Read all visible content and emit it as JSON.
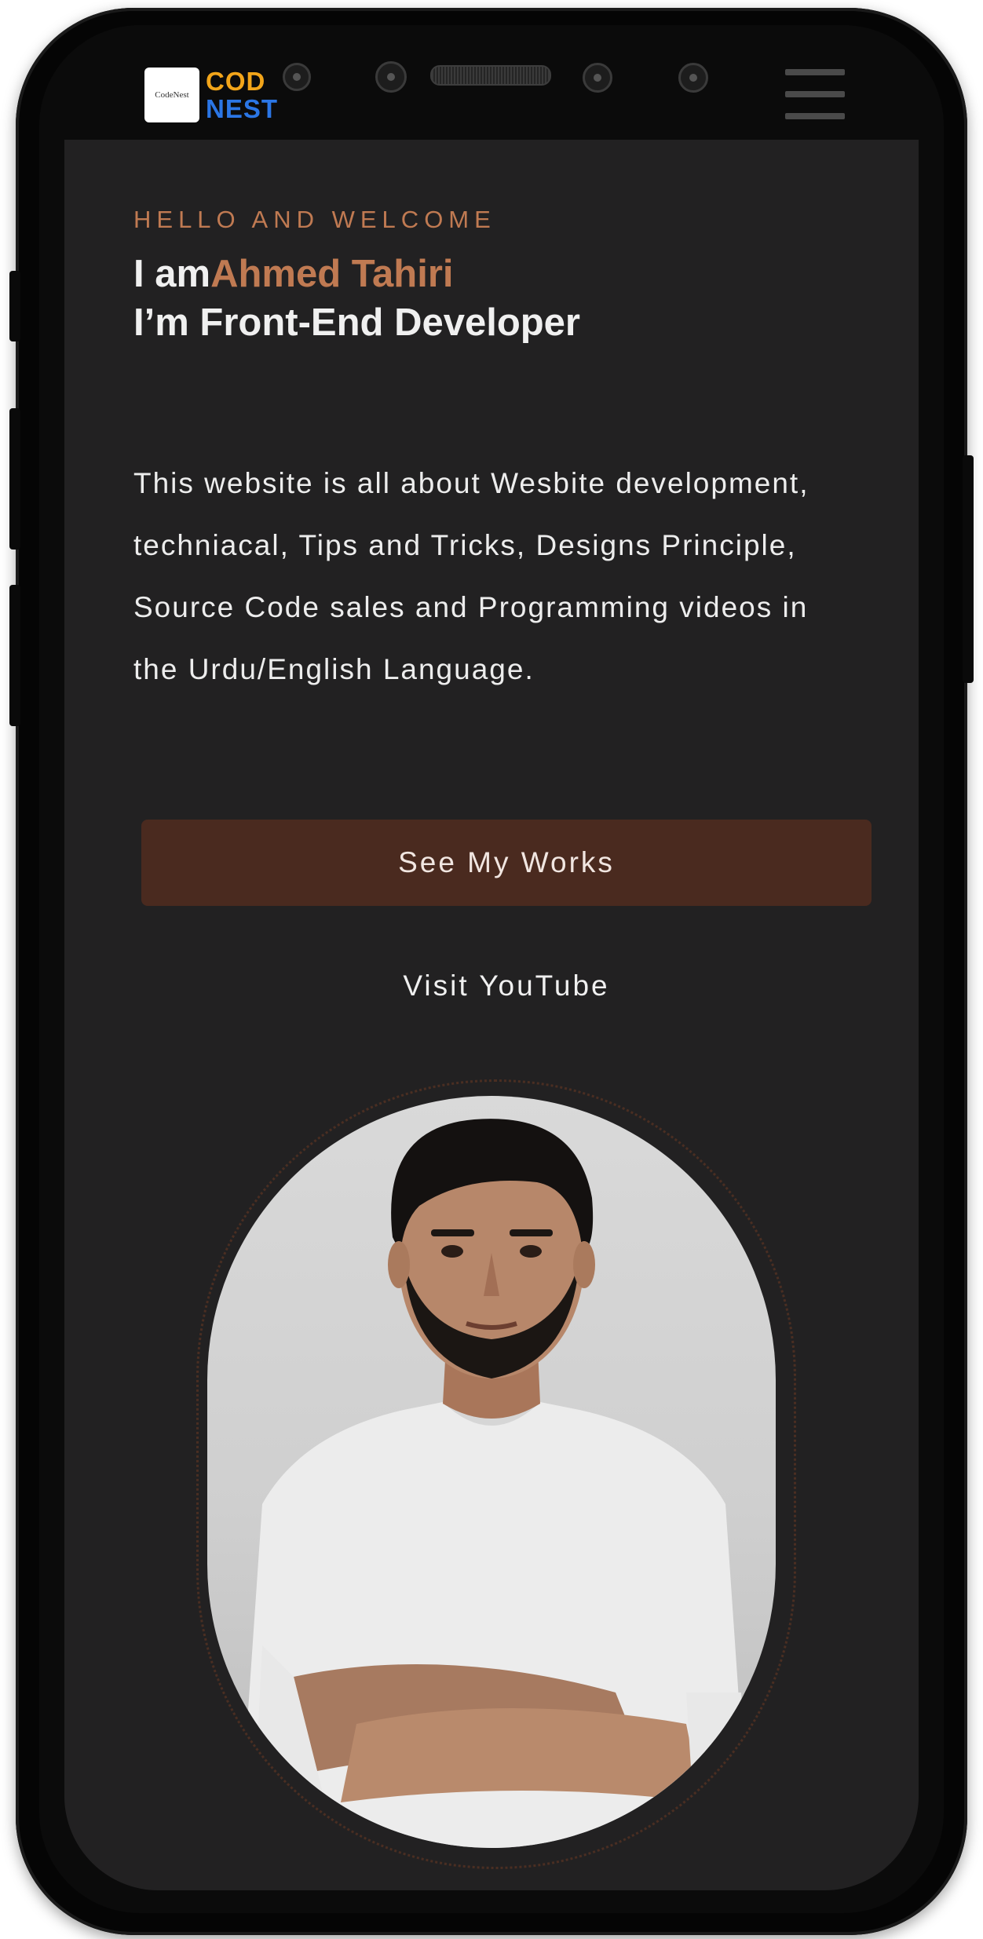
{
  "header": {
    "logo_small_text": "CodeNest",
    "logo_line1": "COD",
    "logo_line2": "NEST",
    "menu_icon": "hamburger-icon"
  },
  "hero": {
    "kicker": "HELLO AND  WELCOME",
    "intro_prefix": "I am",
    "intro_name": "Ahmed Tahiri",
    "role_line": "I’m Front-End Developer",
    "description": "This website is all about Wesbite development, techniacal, Tips and Tricks, Designs Principle, Source Code sales and Programming videos in the Urdu/English Language.",
    "primary_button": "See My Works",
    "secondary_link": "Visit YouTube"
  },
  "colors": {
    "background": "#222122",
    "accent": "#c07a52",
    "button_bg": "#4a2a1f",
    "logo_yellow": "#f2a51a",
    "logo_blue": "#2b76e5"
  }
}
